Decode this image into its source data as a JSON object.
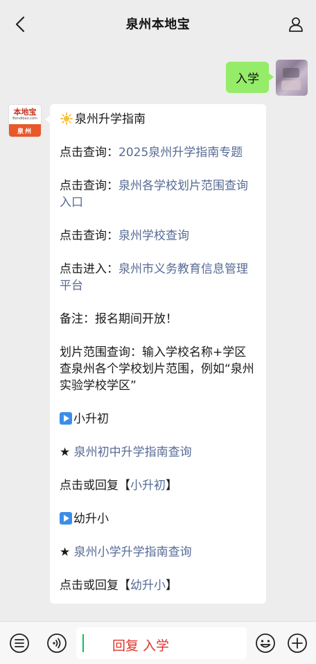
{
  "header": {
    "title": "泉州本地宝",
    "back_icon": "chevron-left-icon",
    "profile_icon": "person-icon"
  },
  "user_message": {
    "text": "入学"
  },
  "bot_avatar": {
    "logo_main": "本地宝",
    "logo_sub": "Bendibao.com",
    "city": "泉州"
  },
  "bot_message": {
    "heading": "泉州升学指南",
    "items": [
      {
        "prefix": "点击查询：",
        "link": "2025泉州升学指南专题"
      },
      {
        "prefix": "点击查询：",
        "link": "泉州各学校划片范围查询入口"
      },
      {
        "prefix": "点击查询：",
        "link": "泉州学校查询"
      },
      {
        "prefix": "点击进入：",
        "link": "泉州市义务教育信息管理平台"
      }
    ],
    "note": "备注：报名期间开放！",
    "range_query": "划片范围查询：输入学校名称+学区查泉州各个学校划片范围，例如“泉州实验学校学区”",
    "section1": {
      "title": "小升初",
      "star_link": "泉州初中升学指南查询",
      "reply_prefix": "点击或回复【",
      "reply_link": "小升初",
      "reply_suffix": "】"
    },
    "section2": {
      "title": "幼升小",
      "star_link": "泉州小学升学指南查询",
      "reply_prefix": "点击或回复【",
      "reply_link": "幼升小",
      "reply_suffix": "】"
    }
  },
  "input_bar": {
    "draft_text": "回复 入学",
    "icons": [
      "menu-icon",
      "voice-icon",
      "emoji-icon",
      "plus-icon"
    ]
  },
  "colors": {
    "background": "#ededed",
    "user_bubble": "#95ec69",
    "link": "#576b95",
    "draft_text": "#e0322c",
    "caret": "#07c160"
  }
}
